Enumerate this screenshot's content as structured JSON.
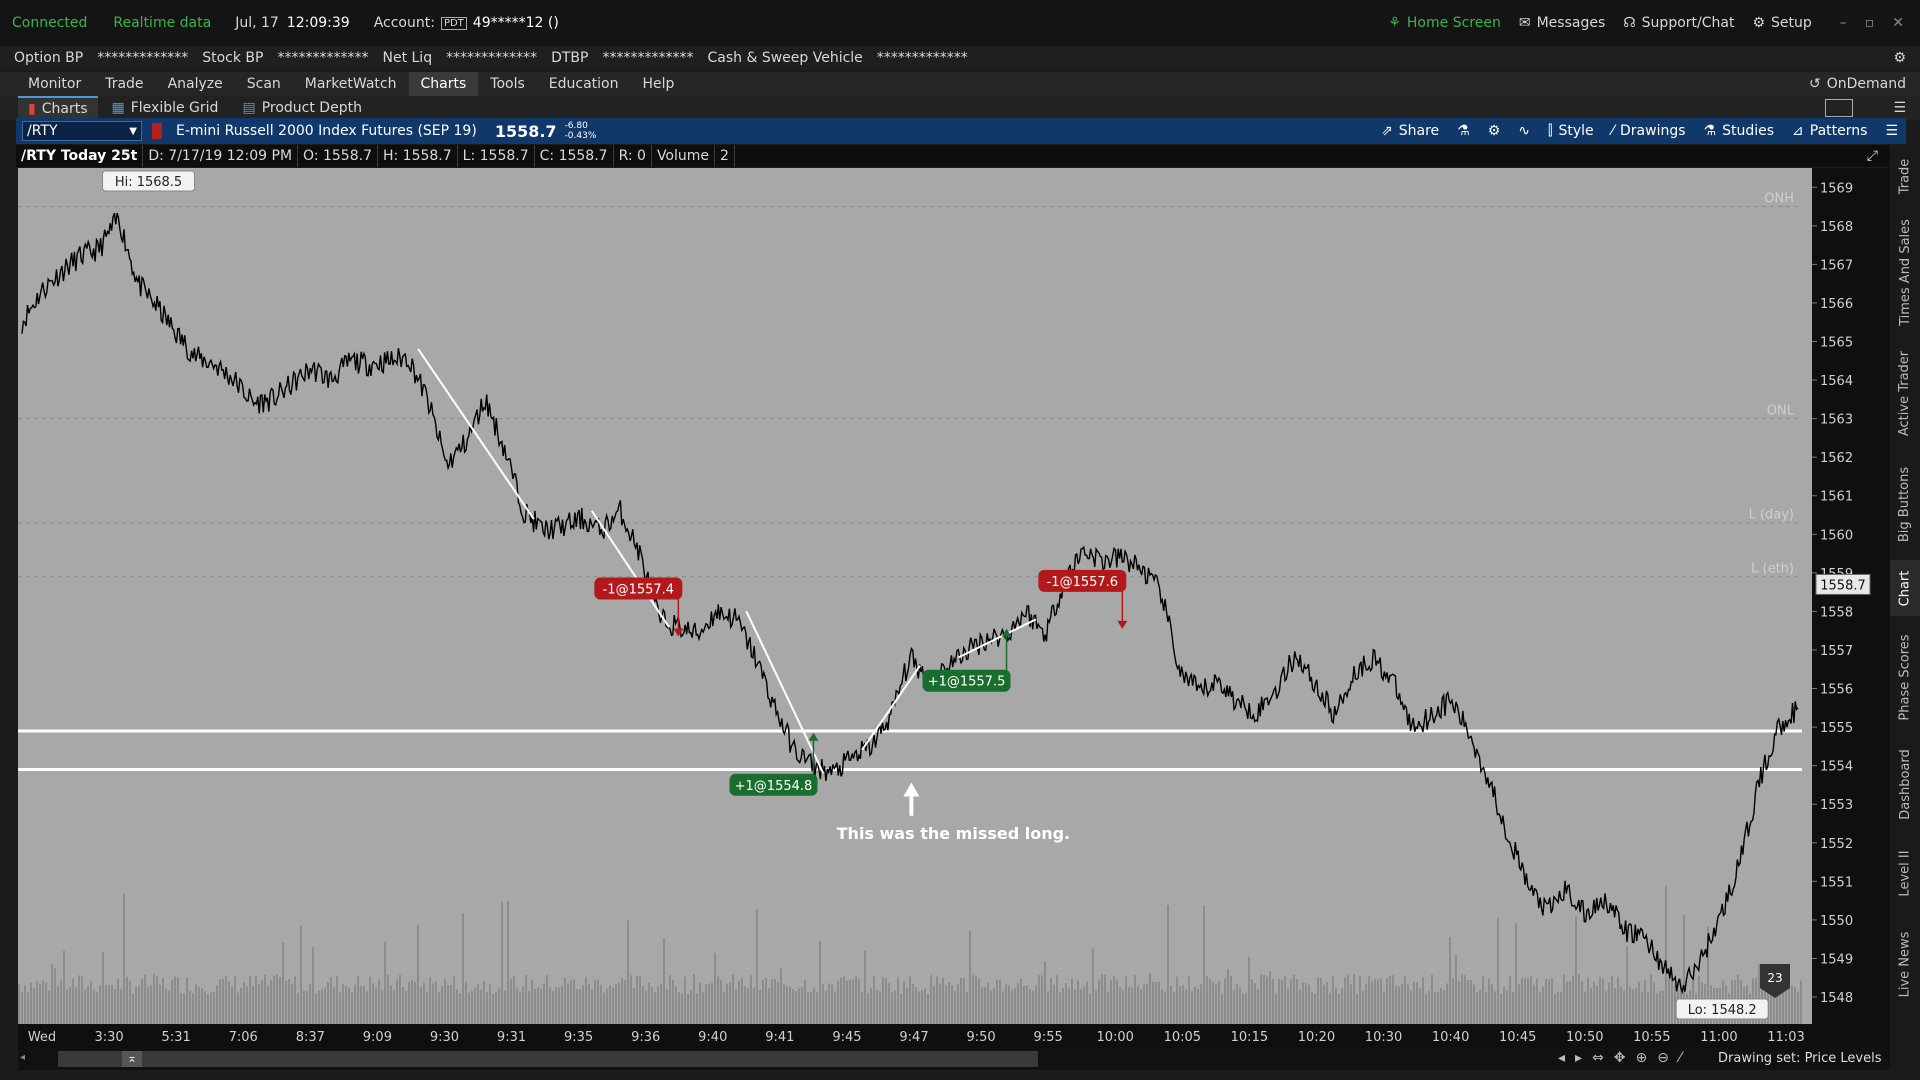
{
  "status": {
    "connected": "Connected",
    "realtime": "Realtime data",
    "date": "Jul, 17",
    "time": "12:09:39",
    "account_label": "Account:",
    "account_badge": "PDT",
    "account_number": "49*****12 ()",
    "home": "Home Screen",
    "messages": "Messages",
    "support": "Support/Chat",
    "setup": "Setup"
  },
  "balances": [
    {
      "label": "Option BP",
      "value": "*************"
    },
    {
      "label": "Stock BP",
      "value": "*************"
    },
    {
      "label": "Net Liq",
      "value": "*************"
    },
    {
      "label": "DTBP",
      "value": "*************"
    },
    {
      "label": "Cash & Sweep Vehicle",
      "value": "*************"
    }
  ],
  "menu": [
    "Monitor",
    "Trade",
    "Analyze",
    "Scan",
    "MarketWatch",
    "Charts",
    "Tools",
    "Education",
    "Help"
  ],
  "menu_active": "Charts",
  "ondemand": "OnDemand",
  "subtabs": [
    "Charts",
    "Flexible Grid",
    "Product Depth"
  ],
  "chart_header": {
    "symbol": "/RTY",
    "description": "E-mini Russell 2000 Index Futures (SEP 19)",
    "last": "1558.7",
    "change": "-6.80",
    "change_pct": "-0.43%",
    "share": "Share",
    "style": "Style",
    "drawings": "Drawings",
    "studies": "Studies",
    "patterns": "Patterns"
  },
  "info": {
    "period": "/RTY Today 25t",
    "date": "D: 7/17/19 12:09 PM",
    "open": "O: 1558.7",
    "high": "H: 1558.7",
    "low": "L: 1558.7",
    "close": "C: 1558.7",
    "range": "R: 0",
    "volume_label": "Volume",
    "volume": "2"
  },
  "side_tabs": [
    "Trade",
    "Times And Sales",
    "Active Trader",
    "Big Buttons",
    "Chart",
    "Phase Scores",
    "Dashboard",
    "Level II",
    "Live News"
  ],
  "side_tab_active": "Chart",
  "drawing_set": "Drawing set: Price Levels",
  "chart_data": {
    "type": "line",
    "ylim": [
      1547.3,
      1569.5
    ],
    "price_ticks": [
      1548,
      1549,
      1550,
      1551,
      1552,
      1553,
      1554,
      1555,
      1556,
      1557,
      1558,
      1559,
      1560,
      1561,
      1562,
      1563,
      1564,
      1565,
      1566,
      1567,
      1568,
      1569
    ],
    "last_price_label": "1558.7",
    "time_labels": [
      "Wed",
      "3:30",
      "5:31",
      "7:06",
      "8:37",
      "9:09",
      "9:30",
      "9:31",
      "9:35",
      "9:36",
      "9:40",
      "9:41",
      "9:45",
      "9:47",
      "9:50",
      "9:55",
      "10:00",
      "10:05",
      "10:15",
      "10:20",
      "10:30",
      "10:40",
      "10:45",
      "10:50",
      "10:55",
      "11:00",
      "11:03"
    ],
    "series": [
      {
        "values": [
          1565.5,
          1566.3,
          1566.8,
          1567.2,
          1567.4,
          1568.2,
          1566.5,
          1565.9,
          1565.2,
          1564.6,
          1564.4,
          1564.0,
          1563.4,
          1563.5,
          1563.9,
          1564.3,
          1564.0,
          1564.5,
          1564.4,
          1564.5,
          1564.6,
          1563.5,
          1561.8,
          1562.4,
          1563.5,
          1562.2,
          1560.6,
          1560.1,
          1560.2,
          1560.4,
          1560.1,
          1560.6,
          1559.5,
          1557.8,
          1557.6,
          1557.4,
          1558.0,
          1557.8,
          1556.8,
          1555.5,
          1554.4,
          1554.0,
          1553.8,
          1554.2,
          1554.5,
          1555.3,
          1556.8,
          1556.2,
          1556.6,
          1557.0,
          1557.3,
          1557.4,
          1558.0,
          1557.4,
          1558.8,
          1559.6,
          1559.3,
          1559.4,
          1559.1,
          1558.5,
          1556.4,
          1555.9,
          1556.2,
          1555.6,
          1555.4,
          1556.0,
          1556.9,
          1556.1,
          1555.3,
          1556.4,
          1556.8,
          1556.2,
          1555.0,
          1555.3,
          1555.7,
          1554.8,
          1553.6,
          1552.2,
          1550.9,
          1550.2,
          1550.8,
          1550.1,
          1550.6,
          1549.7,
          1549.6,
          1548.8,
          1548.2,
          1549.0,
          1550.1,
          1551.5,
          1553.6,
          1555.0,
          1555.5
        ]
      }
    ],
    "hi_label": "Hi: 1568.5",
    "lo_label": "Lo: 1548.2",
    "level_lines": [
      {
        "label": "ONH",
        "price": 1568.5
      },
      {
        "label": "ONL",
        "price": 1563.0
      },
      {
        "label": "L (day)",
        "price": 1560.3
      },
      {
        "label": "L (eth)",
        "price": 1558.9
      }
    ],
    "horizontal_lines": [
      1554.9,
      1553.9
    ],
    "trades": [
      {
        "label": "-1@1557.4",
        "side": "sell",
        "price": 1557.4
      },
      {
        "label": "-1@1557.6",
        "side": "sell",
        "price": 1557.6
      },
      {
        "label": "+1@1557.5",
        "side": "buy",
        "price": 1557.5
      },
      {
        "label": "+1@1554.8",
        "side": "buy",
        "price": 1554.8
      }
    ],
    "annotation": "This was the missed long.",
    "badge": "23",
    "colors": {
      "background": "#a8a8a8",
      "price": "#000000",
      "sell": "#b3191b",
      "buy": "#196e2e",
      "lines": "#ffffff"
    }
  }
}
